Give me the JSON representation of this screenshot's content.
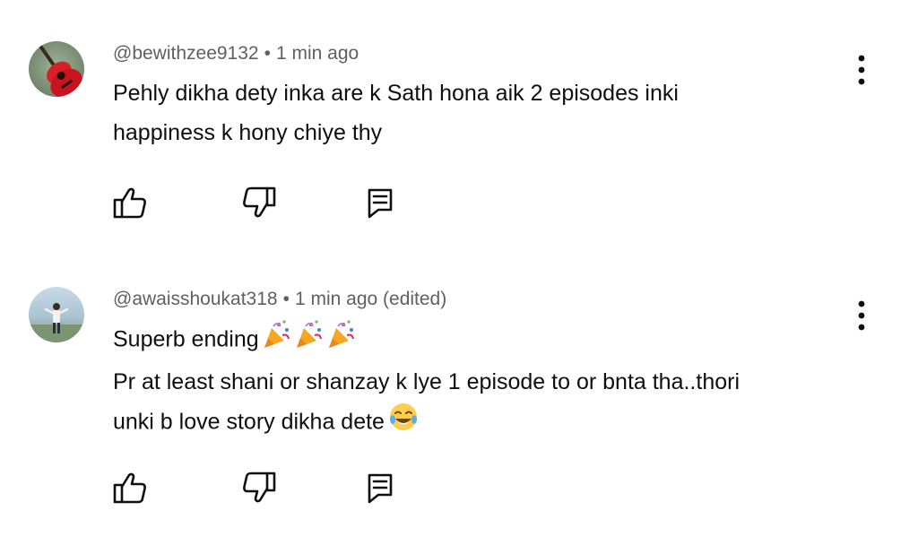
{
  "comments": [
    {
      "author": "@bewithzee9132",
      "separator": "•",
      "time": "1 min ago",
      "lines": [
        "Pehly dikha dety inka are k Sath hona aik 2 episodes inki",
        "happiness k hony chiye thy"
      ],
      "avatar_icon": "guitar-avatar",
      "avatar_color": "#d8202a"
    },
    {
      "author": "@awaisshoukat318",
      "separator": "•",
      "time": "1 min ago (edited)",
      "lines": [
        "Superb ending",
        "Pr at least shani or shanzay k lye 1 episode to or bnta tha..thori",
        "unki b love story dikha dete"
      ],
      "line_emojis": [
        "party-popper-emoji x3",
        "",
        "tears-of-joy-emoji"
      ],
      "avatar_icon": "person-photo-avatar",
      "avatar_color": "#8fb0c4"
    }
  ],
  "icons": {
    "like": "thumbs-up-icon",
    "dislike": "thumbs-down-icon",
    "reply": "reply-icon",
    "more": "more-vertical-icon"
  },
  "colors": {
    "text": "#0f0f0f",
    "meta": "#606060",
    "icon": "#0f0f0f"
  }
}
